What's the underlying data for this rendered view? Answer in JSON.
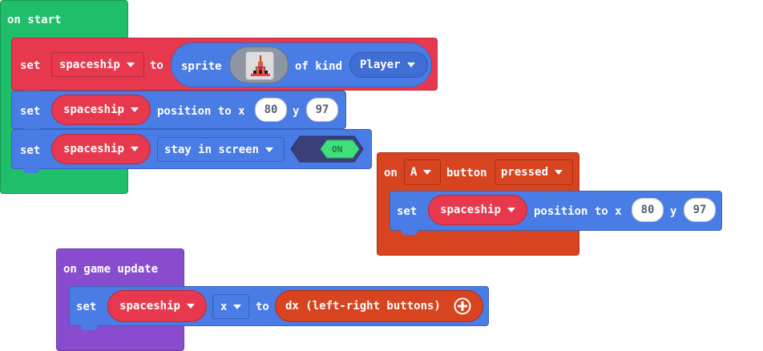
{
  "on_start": {
    "header": "on start",
    "set_sprite": {
      "set_label": "set",
      "variable": "spaceship",
      "to_label": "to",
      "sprite_label": "sprite",
      "of_kind_label": "of kind",
      "kind": "Player"
    },
    "set_position": {
      "set_label": "set",
      "variable": "spaceship",
      "position_label": "position to x",
      "x": "80",
      "y_label": "y",
      "y": "97"
    },
    "set_stay": {
      "set_label": "set",
      "variable": "spaceship",
      "flag": "stay in screen",
      "toggle": "ON"
    }
  },
  "on_button": {
    "on_label": "on",
    "button": "A",
    "button_label": "button",
    "event": "pressed",
    "set_position": {
      "set_label": "set",
      "variable": "spaceship",
      "position_label": "position to x",
      "x": "80",
      "y_label": "y",
      "y": "97"
    }
  },
  "on_game_update": {
    "header": "on game update",
    "set_x": {
      "set_label": "set",
      "variable": "spaceship",
      "property": "x",
      "to_label": "to",
      "value": "dx (left-right buttons)"
    }
  },
  "colors": {
    "events_green": "#1fbe6b",
    "sprites_red": "#e8384e",
    "sprites_blue": "#4a7ce6",
    "controller_orange": "#d7441f",
    "game_purple": "#8a4cce"
  },
  "icons": {
    "sprite_thumbnail": "spaceship-sprite-icon",
    "expand": "plus-circle-icon",
    "dropdown": "chevron-down-icon"
  }
}
